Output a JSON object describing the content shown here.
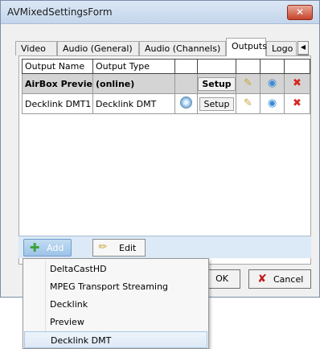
{
  "window": {
    "title": "AVMixedSettingsForm",
    "close_glyph": "✕"
  },
  "tabs": [
    "Video",
    "Audio (General)",
    "Audio (Channels)",
    "Outputs",
    "Logo"
  ],
  "tab_scroll": {
    "left": "◀",
    "right": "▶"
  },
  "grid": {
    "columns": [
      "Output Name",
      "Output Type"
    ],
    "rows": [
      {
        "name": "AirBox Preview",
        "type": "(online)",
        "setup": "Setup"
      },
      {
        "name": "Decklink DMT1",
        "type": "Decklink DMT",
        "setup": "Setup"
      }
    ]
  },
  "toolbar": {
    "add_label": "Add",
    "edit_label": "Edit"
  },
  "dialog": {
    "ok_label": "OK",
    "cancel_label": "Cancel"
  },
  "menu": {
    "items": [
      "DeltaCastHD",
      "MPEG Transport Streaming",
      "Decklink",
      "Preview",
      "Decklink DMT"
    ],
    "selected_index": 4
  },
  "icons": {
    "tools": "tools-icon",
    "globe": "globe-icon",
    "delete": "delete-icon",
    "disc": "disc-icon"
  }
}
